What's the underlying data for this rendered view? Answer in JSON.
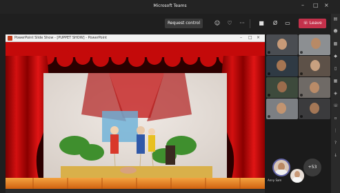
{
  "window": {
    "title": "Microsoft Teams"
  },
  "toolbar": {
    "request_control_label": "Request control",
    "leave_label": "Leave",
    "more_label": "···"
  },
  "shared_window": {
    "title": "PowerPoint Slide Show - [PUPPET SHOW] - PowerPoint",
    "close_label": "×"
  },
  "gallery": {
    "featured_name": "Anny Sam",
    "overflow_count": "+53"
  },
  "colors": {
    "leave": "#c4314b",
    "teams_accent": "#6264a7",
    "curtain": "#c40a0a",
    "stage_floor": "#e07a1a"
  }
}
